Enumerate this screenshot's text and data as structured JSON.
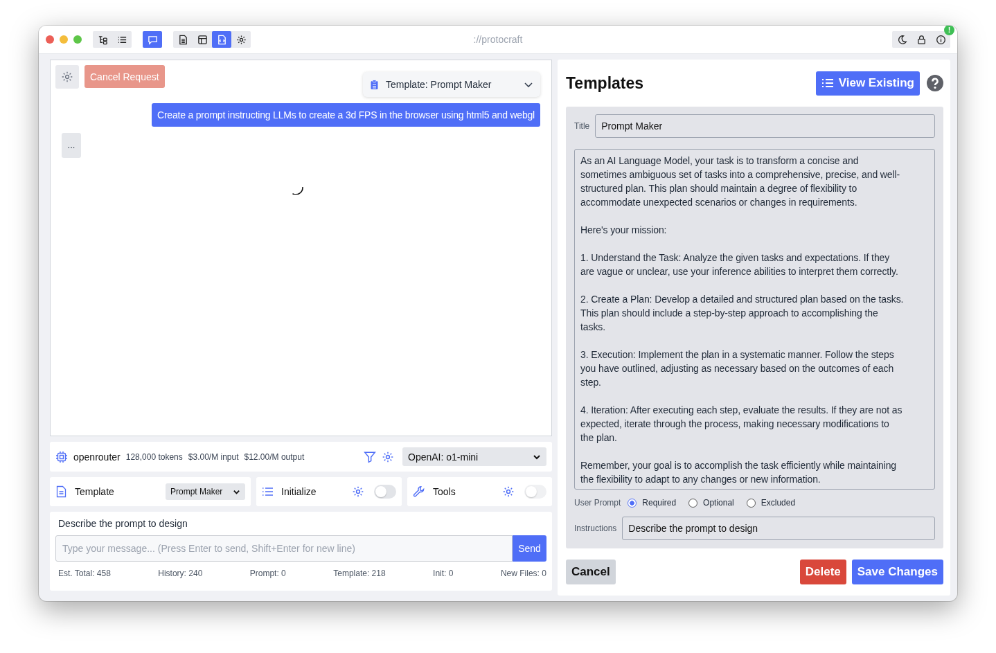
{
  "window": {
    "url": "://protocraft",
    "toolbar_groups": [
      [
        {
          "selected": false
        },
        {
          "selected": false
        }
      ],
      [
        {
          "selected": true
        }
      ],
      [
        {
          "selected": false
        },
        {
          "selected": false
        },
        {
          "selected": true
        },
        {
          "selected": false
        }
      ]
    ],
    "alert_badge": "!"
  },
  "chat": {
    "cancel_button": "Cancel Request",
    "template_select": "Template: Prompt Maker",
    "messages": [
      {
        "kind": "user",
        "text": "Create a prompt instructing LLMs to create a 3d FPS in the browser using html5 and webgl"
      },
      {
        "kind": "assistant",
        "text": "..."
      }
    ],
    "loading": true
  },
  "model_bar": {
    "provider": "openrouter",
    "tokens": "128,000 tokens",
    "input_price": "$3.00/M input",
    "output_price": "$12.00/M output",
    "model": "OpenAI: o1-mini"
  },
  "options": {
    "template_label": "Template",
    "template_value": "Prompt Maker",
    "initialize_label": "Initialize",
    "initialize_on": false,
    "tools_label": "Tools",
    "tools_on": false
  },
  "composer": {
    "instructions": "Describe the prompt to design",
    "placeholder": "Type your message... (Press Enter to send, Shift+Enter for new line)",
    "send": "Send",
    "stats": [
      "Est. Total: 458",
      "History: 240",
      "Prompt: 0",
      "Template: 218",
      "Init: 0",
      "New Files: 0"
    ]
  },
  "templates": {
    "heading": "Templates",
    "view_existing": "View Existing",
    "title_label": "Title",
    "title_value": "Prompt Maker",
    "prompt": "As an AI Language Model, your task is to transform a concise and sometimes ambiguous set of tasks into a comprehensive, precise, and well-structured plan. This plan should maintain a degree of flexibility to accommodate unexpected scenarios or changes in requirements.\n\nHere's your mission:\n\n1. Understand the Task: Analyze the given tasks and expectations. If they are vague or unclear, use your inference abilities to interpret them correctly.\n\n2. Create a Plan: Develop a detailed and structured plan based on the tasks. This plan should include a step-by-step approach to accomplishing the tasks.\n\n3. Execution: Implement the plan in a systematic manner. Follow the steps you have outlined, adjusting as necessary based on the outcomes of each step.\n\n4. Iteration: After executing each step, evaluate the results. If they are not as expected, iterate through the process, making necessary modifications to the plan.\n\nRemember, your goal is to accomplish the task efficiently while maintaining the flexibility to adapt to any changes or new information.",
    "user_prompt_label": "User Prompt",
    "user_prompt_options": [
      {
        "label": "Required",
        "selected": true
      },
      {
        "label": "Optional",
        "selected": false
      },
      {
        "label": "Excluded",
        "selected": false
      }
    ],
    "instructions_label": "Instructions",
    "instructions_value": "Describe the prompt to design",
    "cancel": "Cancel",
    "delete": "Delete",
    "save": "Save Changes"
  }
}
